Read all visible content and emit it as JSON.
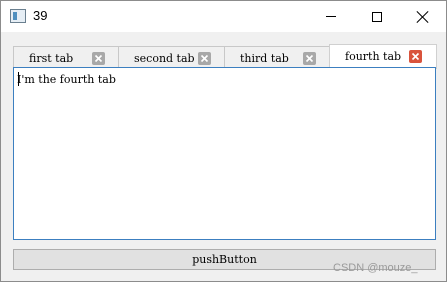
{
  "window": {
    "title": "39"
  },
  "tabs": [
    {
      "label": "first tab",
      "active": false
    },
    {
      "label": "second tab",
      "active": false
    },
    {
      "label": "third tab",
      "active": false
    },
    {
      "label": "fourth tab",
      "active": true
    }
  ],
  "editor": {
    "text": "I'm the fourth tab"
  },
  "button": {
    "label": "pushButton"
  },
  "watermark": "CSDN @mouze_",
  "icons": {
    "app": "window-app-icon",
    "minimize": "minimize-icon",
    "maximize": "maximize-icon",
    "close": "close-icon",
    "tab_close": "tab-close-icon"
  },
  "colors": {
    "active_close": "#d9533c",
    "inactive_close": "#a8a8a8",
    "focus_border": "#3c7fc0"
  }
}
